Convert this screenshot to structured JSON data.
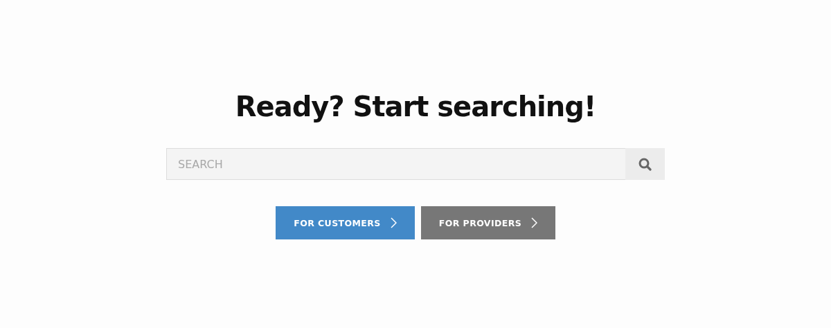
{
  "heading": "Ready? Start searching!",
  "search": {
    "placeholder": "SEARCH"
  },
  "buttons": [
    {
      "label": "FOR CUSTOMERS",
      "kind": "primary"
    },
    {
      "label": "FOR PROVIDERS",
      "kind": "secondary"
    }
  ]
}
